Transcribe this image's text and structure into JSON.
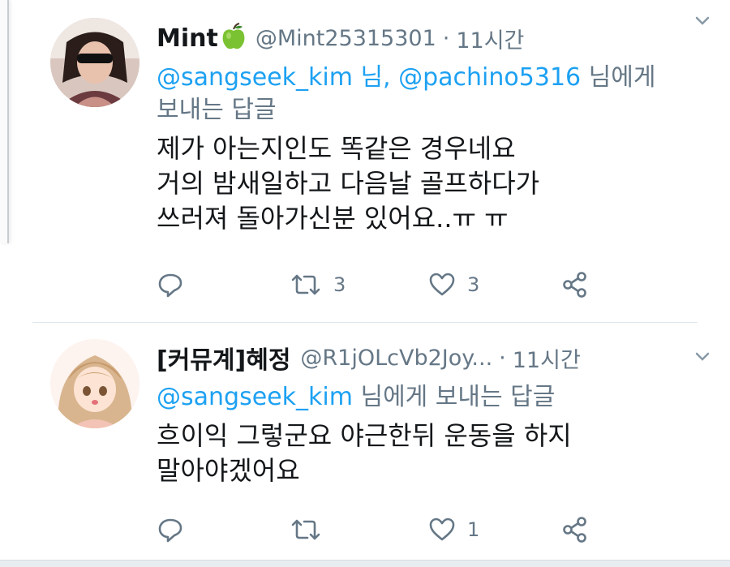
{
  "tweets": [
    {
      "name": "Mint",
      "handle": "@Mint25315301",
      "time": "11시간",
      "reply_to_users": "@sangseek_kim 님, @pachino5316",
      "reply_to_suffix": "님에게",
      "reply_to_line2": "보내는 답글",
      "text_lines": [
        "제가 아는지인도 똑같은 경우네요",
        "거의 밤새일하고 다음날 골프하다가",
        "쓰러져 돌아가신분 있어요..ㅠ ㅠ"
      ],
      "retweets": "3",
      "likes": "3",
      "accent": "#1da1f2"
    },
    {
      "name": "[커뮤계]혜정",
      "handle": "@R1jOLcVb2Joy...",
      "time": "11시간",
      "reply_to_users": "@sangseek_kim",
      "reply_to_suffix": "님에게 보내는 답글",
      "text_lines": [
        "흐이익 그렇군요 야근한뒤 운동을 하지",
        "말아야겠어요"
      ],
      "likes": "1"
    }
  ],
  "icons": {
    "reply": "reply-icon",
    "retweet": "retweet-icon",
    "like": "heart-icon",
    "share": "share-icon",
    "more": "chevron-down-icon",
    "emoji": "green-apple-icon"
  }
}
